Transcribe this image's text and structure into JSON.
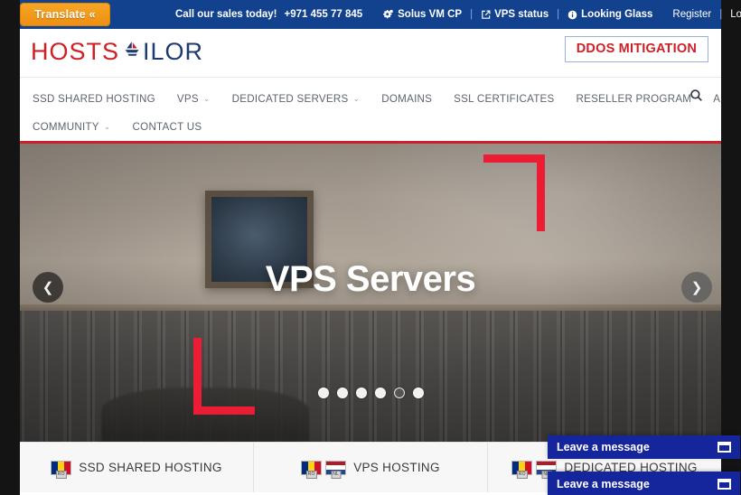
{
  "topbar": {
    "translate_label": "Translate «",
    "sales_text": "Call our sales today!",
    "phone": "+971 455 77 845",
    "solus_label": "Solus VM CP",
    "solus_icon": "gears-icon",
    "vps_status_label": "VPS status",
    "vps_status_icon": "external-link-icon",
    "looking_glass_label": "Looking Glass",
    "looking_glass_icon": "info-icon",
    "separator": "|",
    "register_label": "Register",
    "login_label": "Login"
  },
  "header": {
    "logo_part1": "HOSTS",
    "logo_part2": "ILOR",
    "logo_icon": "sailboat-icon",
    "ddos_label": "DDOS MITIGATION",
    "logo_red": "#cf2027",
    "logo_navy": "#1f3a6e"
  },
  "nav": {
    "row1": [
      {
        "label": "SSD SHARED HOSTING",
        "caret": false
      },
      {
        "label": "VPS",
        "caret": true
      },
      {
        "label": "DEDICATED SERVERS",
        "caret": true
      },
      {
        "label": "DOMAINS",
        "caret": false
      },
      {
        "label": "SSL CERTIFICATES",
        "caret": false
      },
      {
        "label": "RESELLER PROGRAM",
        "caret": false
      },
      {
        "label": "ABOUT US",
        "caret": true
      }
    ],
    "row2": [
      {
        "label": "COMMUNITY",
        "caret": true
      },
      {
        "label": "CONTACT US",
        "caret": false
      }
    ],
    "caret_glyph": "⌄",
    "search_icon": "search-icon",
    "accent_color": "#c9202c"
  },
  "hero": {
    "title": "VPS Servers",
    "prev_icon": "chevron-left-icon",
    "next_icon": "chevron-right-icon",
    "prev_glyph": "❮",
    "next_glyph": "❯",
    "dots_total": 6,
    "active_dot": 5,
    "bracket_color": "#ec1c35"
  },
  "features": [
    {
      "label": "SSD SHARED HOSTING",
      "flags": [
        "RO"
      ]
    },
    {
      "label": "VPS HOSTING",
      "flags": [
        "RO",
        "NL"
      ]
    },
    {
      "label": "DEDICATED HOSTING",
      "flags": [
        "RO",
        "NL"
      ]
    }
  ],
  "chat_widgets": [
    {
      "label": "Leave a message",
      "icon": "window-icon"
    },
    {
      "label": "Leave a message",
      "icon": "window-icon"
    }
  ]
}
